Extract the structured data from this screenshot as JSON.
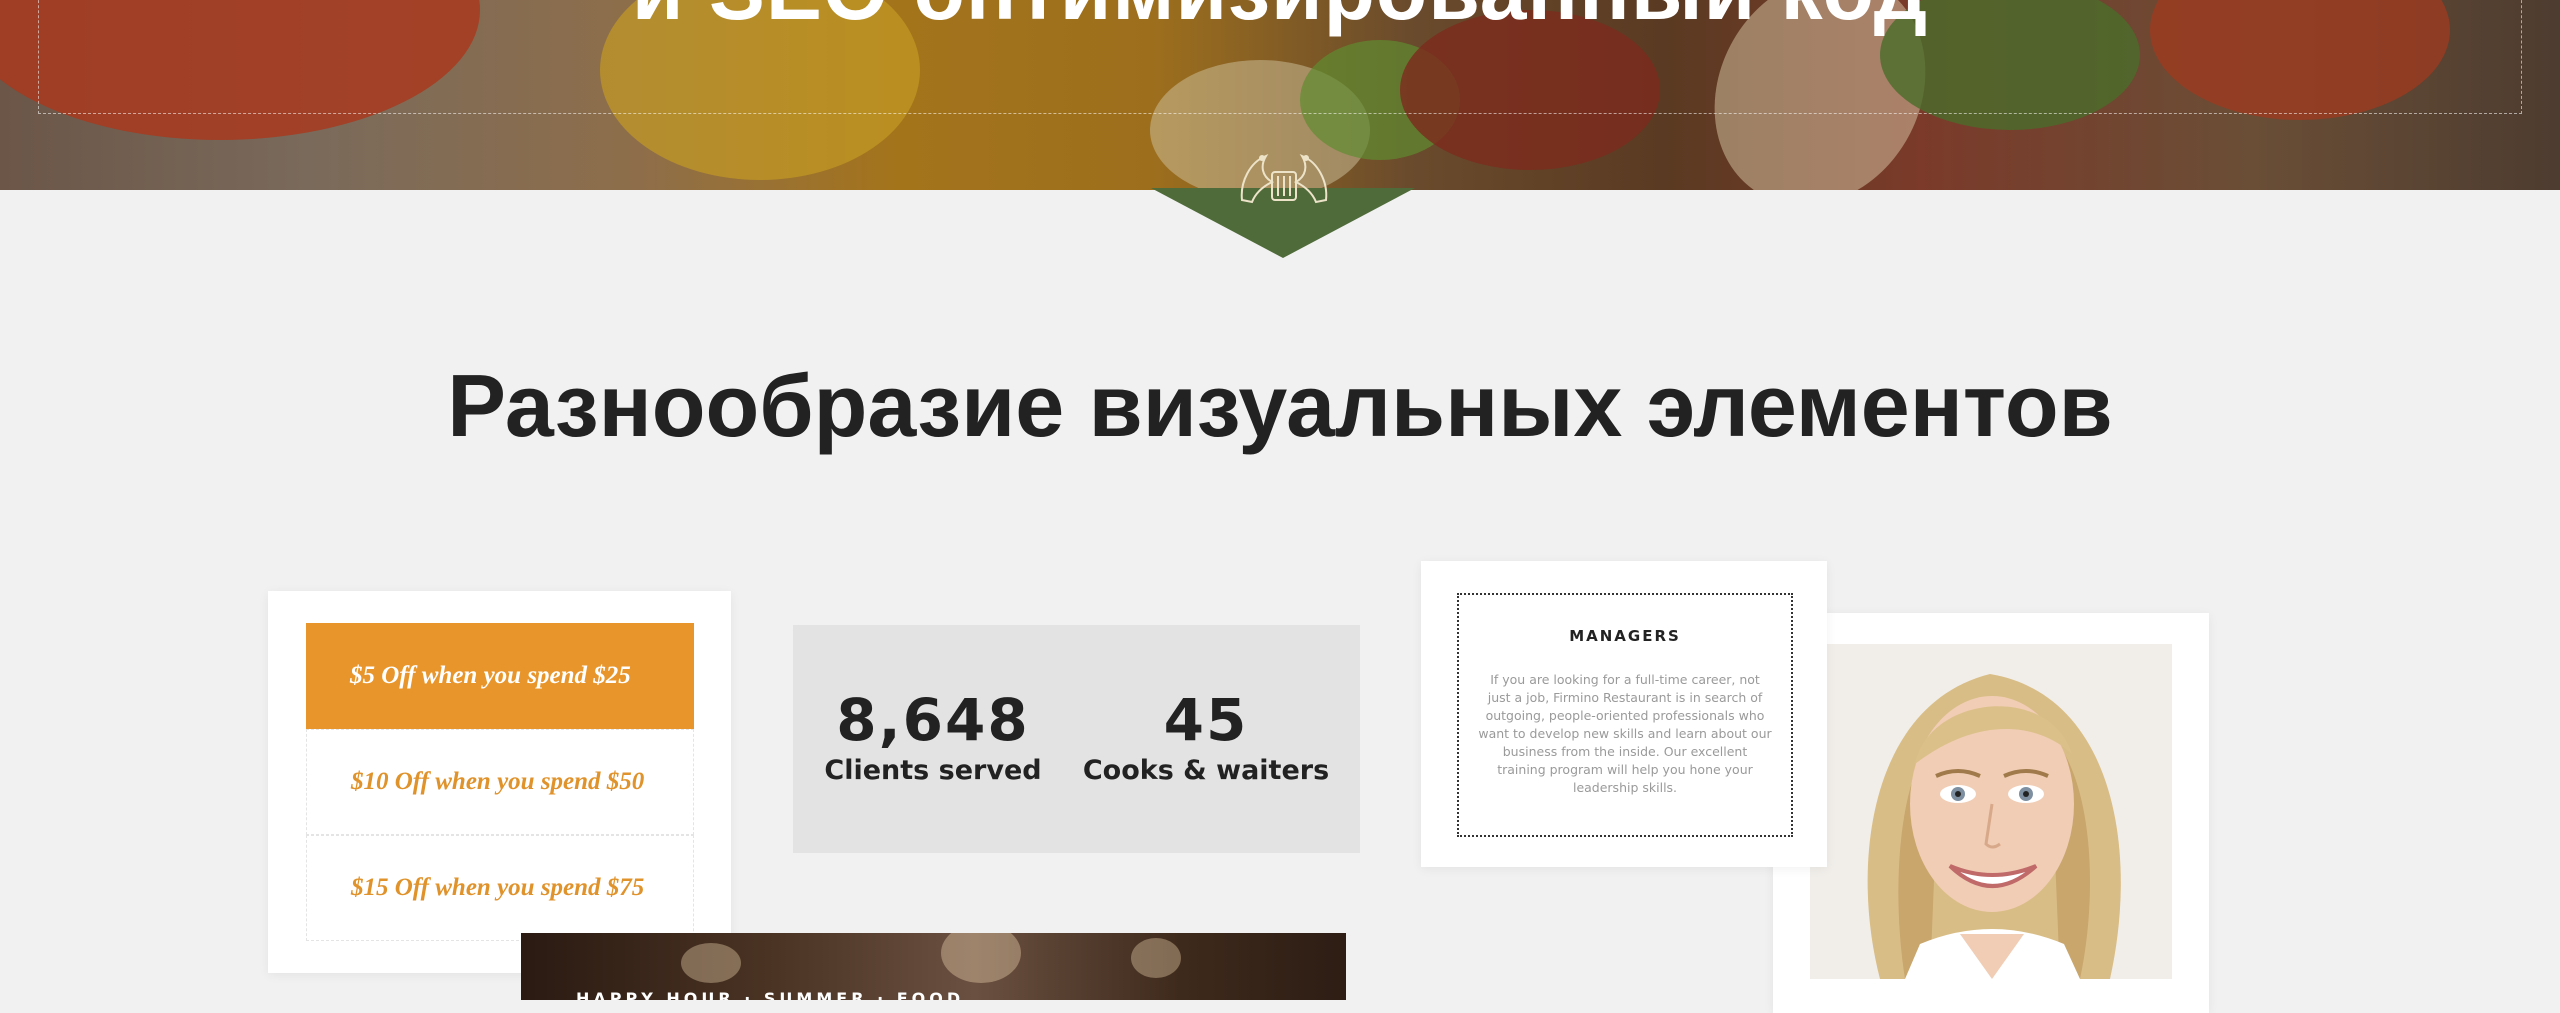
{
  "hero": {
    "title": "и SEO оптимизированный код"
  },
  "section": {
    "heading": "Разнообразие визуальных элементов"
  },
  "offers": {
    "items": [
      {
        "label": "$5 Off when you spend $25"
      },
      {
        "label": "$10 Off when you spend $50"
      },
      {
        "label": "$15 Off when you spend $75"
      }
    ]
  },
  "stats": [
    {
      "value": "8,648",
      "label": "Clients served"
    },
    {
      "value": "45",
      "label": "Cooks & waiters"
    }
  ],
  "managers": {
    "title": "MANAGERS",
    "text": "If you are looking for a full-time career, not just a job, Firmino Restaurant is in search of outgoing, people-oriented professionals who want to develop new skills and learn about our business from the inside. Our excellent training program will help you hone your leadership skills."
  },
  "bottom": {
    "caption": "HAPPY HOUR · SUMMER · FOOD"
  },
  "colors": {
    "accent": "#e8962c",
    "heading": "#222222",
    "background": "#f1f1f1",
    "stats_bg": "#e3e3e3"
  },
  "icons": {
    "crest": "griffin-crest-icon"
  }
}
